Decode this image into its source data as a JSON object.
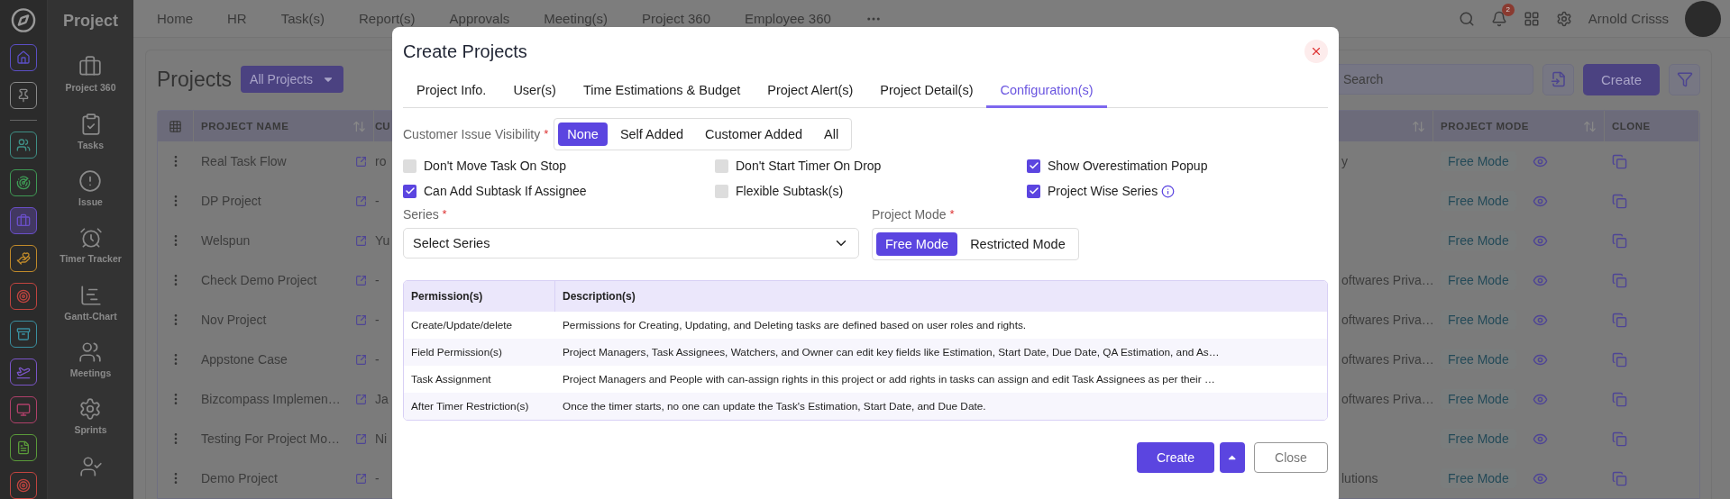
{
  "icon_rail": {
    "items": [
      {
        "color": "#5b4fc4",
        "selected": false
      },
      {
        "color": "#8a8a8a",
        "selected": false
      },
      {
        "color": "#3f8f86",
        "selected": false
      },
      {
        "color": "#3f9a55",
        "selected": false
      },
      {
        "color": "#6a4fc8",
        "selected": true
      },
      {
        "color": "#c08a2a",
        "selected": false
      },
      {
        "color": "#c0443f",
        "selected": false
      },
      {
        "color": "#3a8fa0",
        "selected": false
      },
      {
        "color": "#7a55c8",
        "selected": false
      },
      {
        "color": "#b0406a",
        "selected": false
      },
      {
        "color": "#5a9a3a",
        "selected": false
      },
      {
        "color": "#c0443f",
        "selected": false
      }
    ]
  },
  "sidebar": {
    "title": "Project",
    "items": [
      {
        "label": "Project 360"
      },
      {
        "label": "Tasks"
      },
      {
        "label": "Issue"
      },
      {
        "label": "Timer Tracker"
      },
      {
        "label": "Gantt-Chart"
      },
      {
        "label": "Meetings"
      },
      {
        "label": "Sprints"
      }
    ]
  },
  "topbar": {
    "menu": [
      "Home",
      "HR",
      "Task(s)",
      "Report(s)",
      "Approvals",
      "Meeting(s)",
      "Project 360",
      "Employee 360"
    ],
    "notification_count": "2",
    "user_name": "Arnold Crisss"
  },
  "page": {
    "title": "Projects",
    "filter": "All Projects",
    "search": {
      "placeholder": "Search"
    },
    "create": "Create",
    "table": {
      "columns": [
        "PROJECT NAME",
        "CU",
        "PROJECT MODE",
        "CLONE"
      ],
      "rows": [
        {
          "name": "Real Task Flow",
          "column_3": "ro",
          "column_5": "y",
          "mode": "Free Mode"
        },
        {
          "name": "DP Project",
          "column_3": "-",
          "mode": "Free Mode"
        },
        {
          "name": "Welspun",
          "column_3": "Yu",
          "mode": "Free Mode"
        },
        {
          "name": "Check Demo Project",
          "column_3": "-",
          "column_5": "oftwares Priva…",
          "mode": "Free Mode"
        },
        {
          "name": "Nov Project",
          "column_3": "-",
          "column_5": "oftwares Priva…",
          "mode": "Free Mode"
        },
        {
          "name": "Appstone Case",
          "column_3": "-",
          "column_5": "oftwares Priva…",
          "mode": "Free Mode"
        },
        {
          "name": "Bizcompass Implemen…",
          "column_3": "Ja",
          "column_5": "oftwares Priva…",
          "mode": "Free Mode"
        },
        {
          "name": "Testing For Project Mo…",
          "column_3": "Ni",
          "mode": "Free Mode"
        },
        {
          "name": "Demo Project",
          "column_3": "-",
          "column_5": "lutions",
          "mode": "Free Mode"
        }
      ]
    }
  },
  "modal": {
    "title": "Create Projects",
    "tabs": [
      {
        "label": "Project Info.",
        "selected": false
      },
      {
        "label": "User(s)",
        "selected": false
      },
      {
        "label": "Time Estimations & Budget",
        "selected": false
      },
      {
        "label": "Project Alert(s)",
        "selected": false
      },
      {
        "label": "Project Detail(s)",
        "selected": false
      },
      {
        "label": "Configuration(s)",
        "selected": true
      }
    ],
    "visibility": {
      "label": "Customer Issue Visibility",
      "mark": "*",
      "options": [
        {
          "label": "None",
          "selected": true
        },
        {
          "label": "Self Added",
          "selected": false
        },
        {
          "label": "Customer Added",
          "selected": false
        },
        {
          "label": "All",
          "selected": false
        }
      ]
    },
    "checkboxes": [
      {
        "label": "Don't Move Task On Stop",
        "checked": false
      },
      {
        "label": "Don't Start Timer On Drop",
        "checked": false
      },
      {
        "label": "Show Overestimation Popup",
        "checked": true
      },
      {
        "label": "Can Add Subtask If Assignee",
        "checked": true
      },
      {
        "label": "Flexible Subtask(s)",
        "checked": false
      },
      {
        "label": "Project Wise Series",
        "checked": true,
        "info": true
      }
    ],
    "series": {
      "label": "Series",
      "mark": "*",
      "placeholder": "Select Series"
    },
    "project_mode": {
      "label": "Project Mode",
      "mark": "*",
      "options": [
        {
          "label": "Free Mode",
          "selected": true
        },
        {
          "label": "Restricted Mode",
          "selected": false
        }
      ]
    },
    "permissions": {
      "columns": [
        "Permission(s)",
        "Description(s)"
      ],
      "rows": [
        [
          "Create/Update/delete",
          "Permissions for Creating, Updating, and Deleting tasks are defined based on user roles and rights."
        ],
        [
          "Field Permission(s)",
          "Project Managers, Task Assignees, Watchers, and Owner can edit key fields like Estimation, Start Date, Due Date, QA Estimation, and As…"
        ],
        [
          "Task Assignment",
          "Project Managers and People with can-assign rights in this project or add rights in tasks can assign and edit Task Assignees as per their …"
        ],
        [
          "After Timer Restriction(s)",
          "Once the timer starts, no one can update the Task's Estimation, Start Date, and Due Date."
        ]
      ]
    },
    "buttons": {
      "create": "Create",
      "close": "Close"
    }
  }
}
